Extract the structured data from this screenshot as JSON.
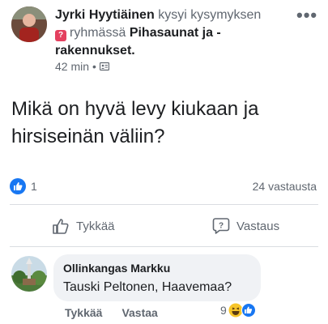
{
  "post": {
    "author": "Jyrki Hyytiäinen",
    "action": "kysyi kysymyksen",
    "in_group": "ryhmässä",
    "group": "Pihasaunat ja -rakennukset.",
    "time": "42 min",
    "question": "Mikä on hyvä levy kiukaan ja hirsiseinän väliin?"
  },
  "stats": {
    "likes": "1",
    "answers": "24 vastausta"
  },
  "actions": {
    "like": "Tykkää",
    "answer": "Vastaus"
  },
  "comment": {
    "author": "Ollinkangas Markku",
    "text": "Tauski Peltonen, Haavemaa?",
    "like": "Tykkää",
    "reply": "Vastaa",
    "reaction_count": "9"
  },
  "colors": {
    "accent": "#1877f2",
    "muted": "#606770",
    "bubble": "#f0f2f5"
  },
  "icons": [
    "more-dots-icon",
    "group-badge-icon",
    "audience-icon",
    "like-reaction-icon",
    "thumbs-up-icon",
    "question-bubble-icon",
    "haha-reaction-icon"
  ]
}
